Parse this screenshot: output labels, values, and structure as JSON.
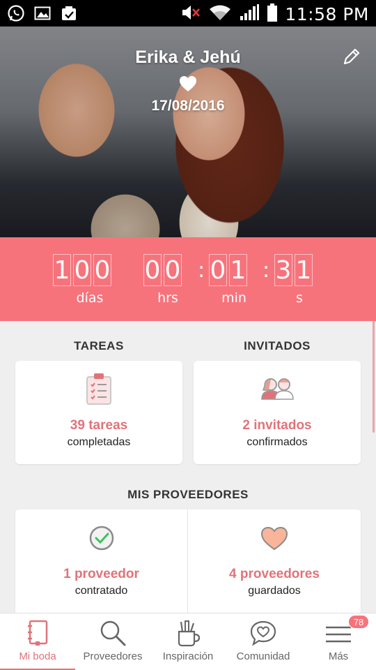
{
  "status_bar": {
    "time": "11:58 PM"
  },
  "hero": {
    "couple": "Erika & Jehú",
    "date": "17/08/2016"
  },
  "countdown": {
    "days": [
      "1",
      "0",
      "0"
    ],
    "hours": [
      "0",
      "0"
    ],
    "minutes": [
      "0",
      "1"
    ],
    "seconds": [
      "3",
      "1"
    ],
    "labels": {
      "days": "días",
      "hours": "hrs",
      "minutes": "min",
      "seconds": "s"
    }
  },
  "tareas": {
    "heading": "TAREAS",
    "count": "39 tareas",
    "status": "completadas"
  },
  "invitados": {
    "heading": "INVITADOS",
    "count": "2 invitados",
    "status": "confirmados"
  },
  "proveedores": {
    "heading": "MIS PROVEEDORES",
    "contratado": {
      "count": "1 proveedor",
      "status": "contratado"
    },
    "guardados": {
      "count": "4 proveedores",
      "status": "guardados"
    }
  },
  "nav": {
    "items": [
      {
        "label": "Mi boda",
        "icon": "notebook-icon"
      },
      {
        "label": "Proveedores",
        "icon": "search-icon"
      },
      {
        "label": "Inspiración",
        "icon": "pencil-cup-icon"
      },
      {
        "label": "Comunidad",
        "icon": "chat-heart-icon"
      },
      {
        "label": "Más",
        "icon": "menu-icon"
      }
    ],
    "badge": "78"
  },
  "colors": {
    "accent": "#f7737c",
    "accent_text": "#e0737a"
  }
}
